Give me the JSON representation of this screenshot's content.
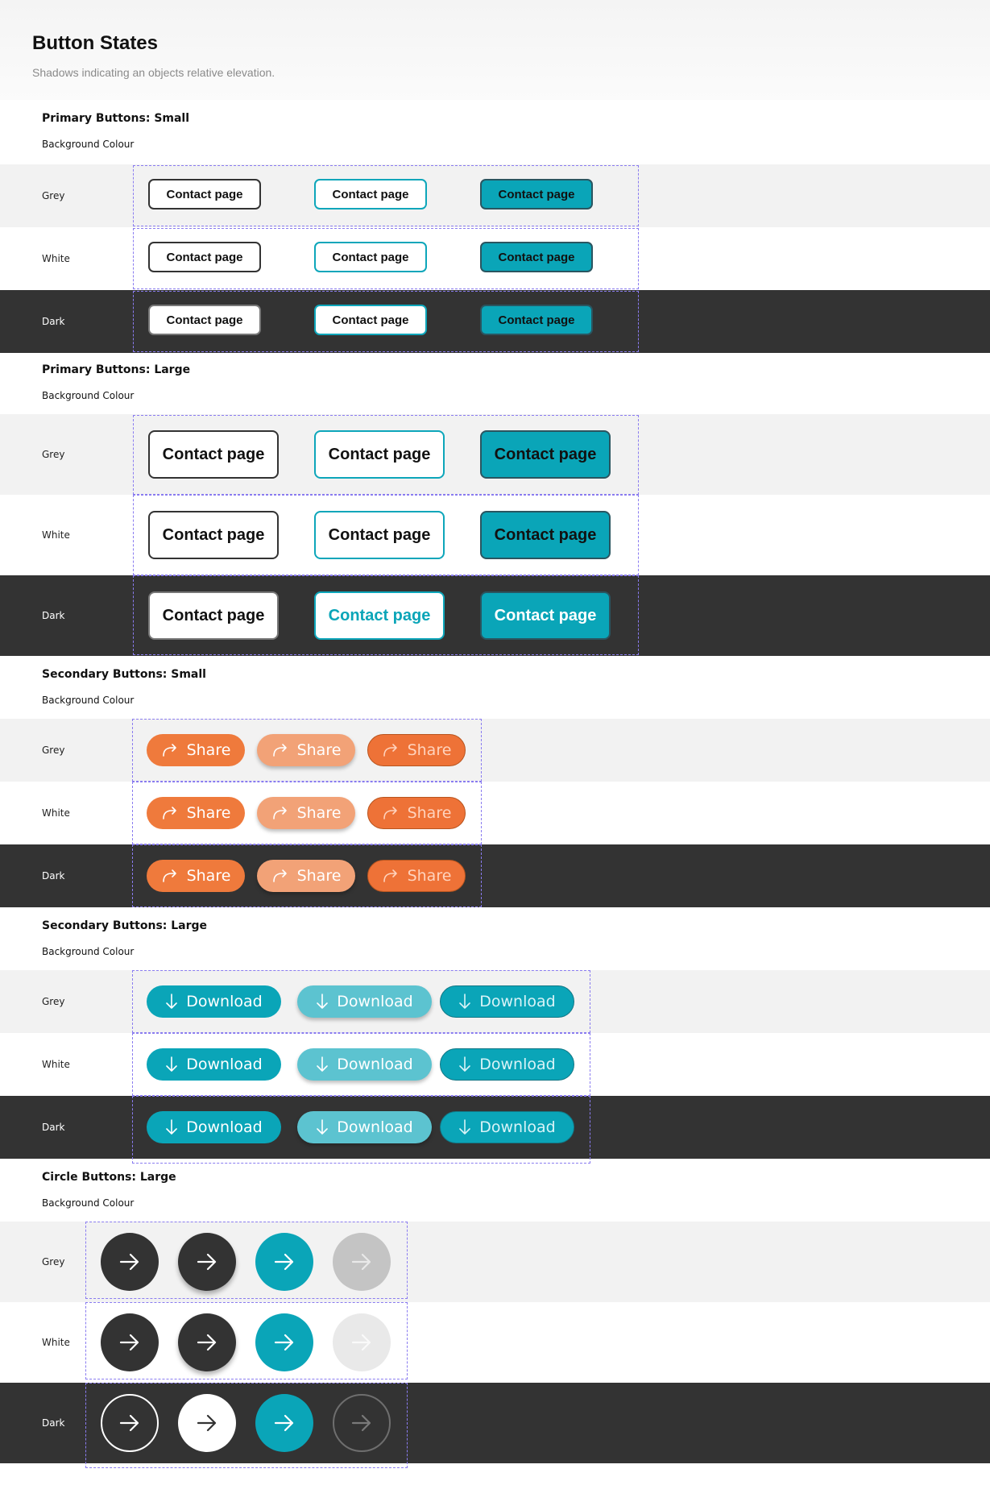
{
  "header": {
    "title": "Button States",
    "subtitle": "Shadows indicating an objects relative elevation."
  },
  "background_label": "Background Colour",
  "band_labels": {
    "grey": "Grey",
    "white": "White",
    "dark": "Dark"
  },
  "sections": {
    "primary_small": {
      "title": "Primary Buttons:  Small"
    },
    "primary_large": {
      "title": "Primary Buttons:  Large"
    },
    "secondary_small": {
      "title": "Secondary Buttons:  Small"
    },
    "secondary_large": {
      "title": "Secondary Buttons:  Large"
    },
    "circle_large": {
      "title": "Circle Buttons:  Large"
    }
  },
  "buttons": {
    "contact_label": "Contact page",
    "share_label": "Share",
    "download_label": "Download"
  },
  "icons": {
    "share": "share-arrow-icon",
    "download": "down-arrow-icon",
    "circle": "right-arrow-icon"
  },
  "colors": {
    "teal": "#0aa5b8",
    "orange": "#ef7a3c",
    "dark": "#333333",
    "grey_band": "#f2f2f2",
    "guide": "#8a7cf0"
  }
}
